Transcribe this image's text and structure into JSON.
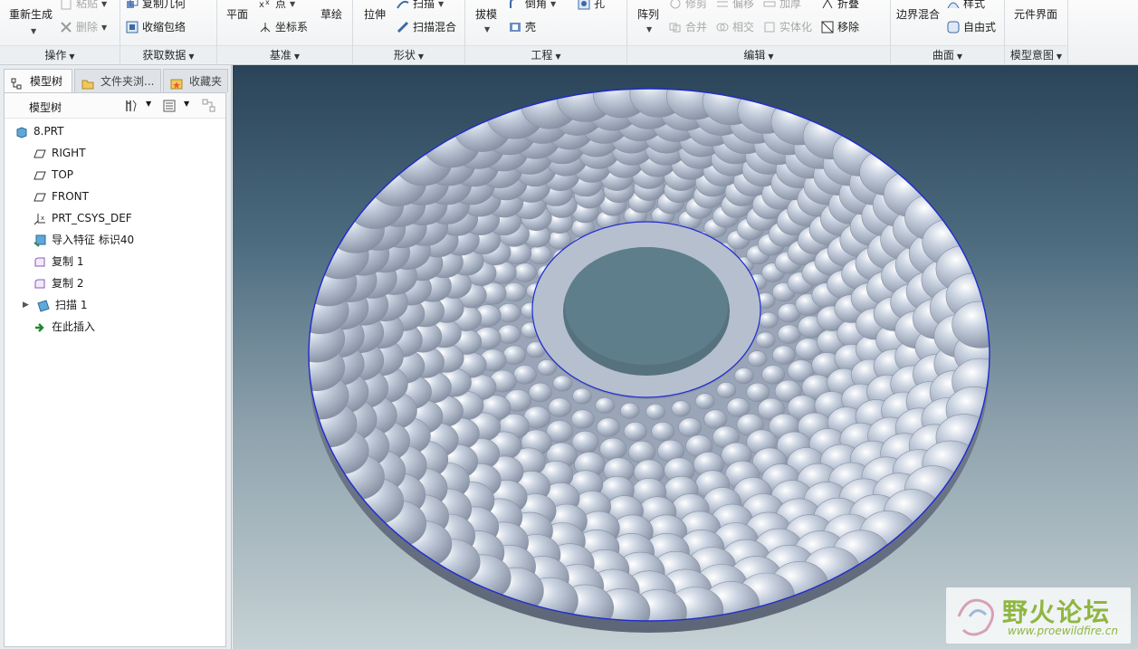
{
  "ribbon": {
    "groups": {
      "operations": "操作",
      "get_data": "获取数据",
      "datum": "基准",
      "shapes": "形状",
      "engineering": "工程",
      "editing": "编辑",
      "surfaces": "曲面",
      "model_intent": "模型意图"
    },
    "buttons": {
      "regenerate": "重新生成",
      "paste": "粘贴",
      "delete": "删除",
      "copy_geometry": "复制几何",
      "shrinkwrap": "收缩包络",
      "plane": "平面",
      "point": "点",
      "csys": "坐标系",
      "sketch": "草绘",
      "extrude": "拉伸",
      "sweep": "扫描",
      "swept_blend": "扫描混合",
      "draft": "拔模",
      "round": "倒角",
      "hole": "孔",
      "shell": "壳",
      "pattern": "阵列",
      "trim": "修剪",
      "offset": "偏移",
      "thicken": "加厚",
      "merge": "合并",
      "intersect": "相交",
      "solidify": "实体化",
      "fold": "折叠",
      "remove": "移除",
      "boundary_blend": "边界混合",
      "style": "样式",
      "freestyle": "自由式",
      "component_interface": "元件界面"
    }
  },
  "panel": {
    "tabs": [
      "模型树",
      "文件夹浏...",
      "收藏夹"
    ],
    "tree_title": "模型树",
    "items": [
      {
        "label": "8.PRT",
        "icon": "part-icon"
      },
      {
        "label": "RIGHT",
        "icon": "datum-plane-icon"
      },
      {
        "label": "TOP",
        "icon": "datum-plane-icon"
      },
      {
        "label": "FRONT",
        "icon": "datum-plane-icon"
      },
      {
        "label": "PRT_CSYS_DEF",
        "icon": "csys-icon"
      },
      {
        "label": "导入特征 标识40",
        "icon": "import-feature-icon"
      },
      {
        "label": "复制 1",
        "icon": "copy-surface-icon"
      },
      {
        "label": "复制 2",
        "icon": "copy-surface-icon"
      },
      {
        "label": "扫描 1",
        "icon": "sweep-feature-icon"
      },
      {
        "label": "在此插入",
        "icon": "insert-here-icon"
      }
    ]
  },
  "watermark": {
    "text": "野火论坛",
    "url": "www.proewildfire.cn"
  },
  "colors": {
    "model_surface": "#a9b4c6",
    "edge_highlight": "#1f2bd0",
    "background_top": "#2a4358",
    "background_bottom": "#c6d2d5",
    "watermark_green": "#8fb640"
  }
}
